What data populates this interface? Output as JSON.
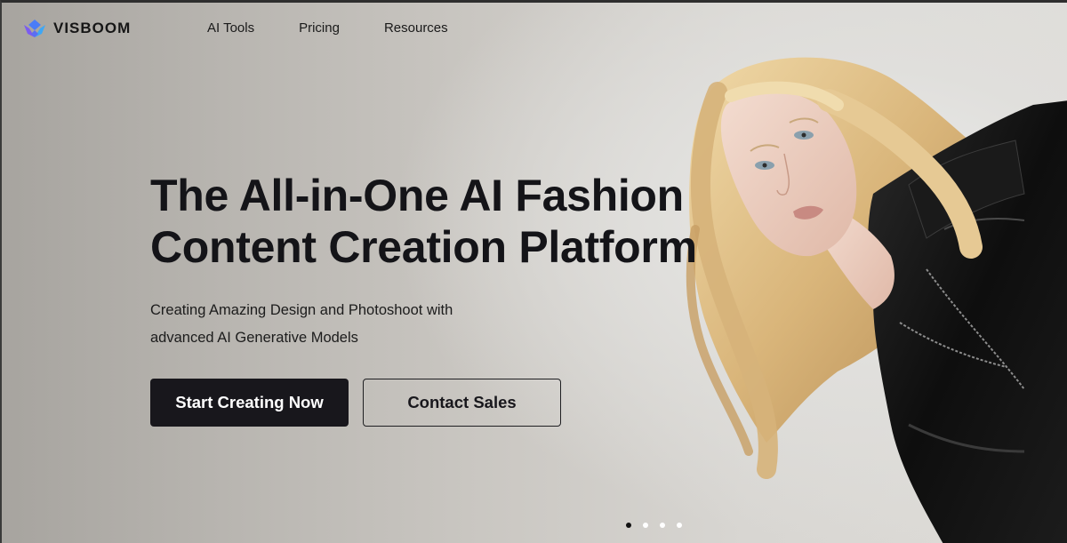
{
  "brand": {
    "name": "VISBOOM",
    "logo_icon": "visboom-logo-icon",
    "accent": "#3f6df0"
  },
  "nav": {
    "items": [
      {
        "label": "AI Tools"
      },
      {
        "label": "Pricing"
      },
      {
        "label": "Resources"
      }
    ]
  },
  "hero": {
    "headline_line1": "The All-in-One AI Fashion",
    "headline_line2": "Content Creation Platform",
    "subtitle_line1": "Creating Amazing Design and Photoshoot with",
    "subtitle_line2": "advanced AI Generative Models",
    "primary_button": "Start Creating Now",
    "secondary_button": "Contact Sales",
    "primary_color": "#18171c"
  },
  "carousel": {
    "slide_count": 4,
    "active_index": 0
  }
}
